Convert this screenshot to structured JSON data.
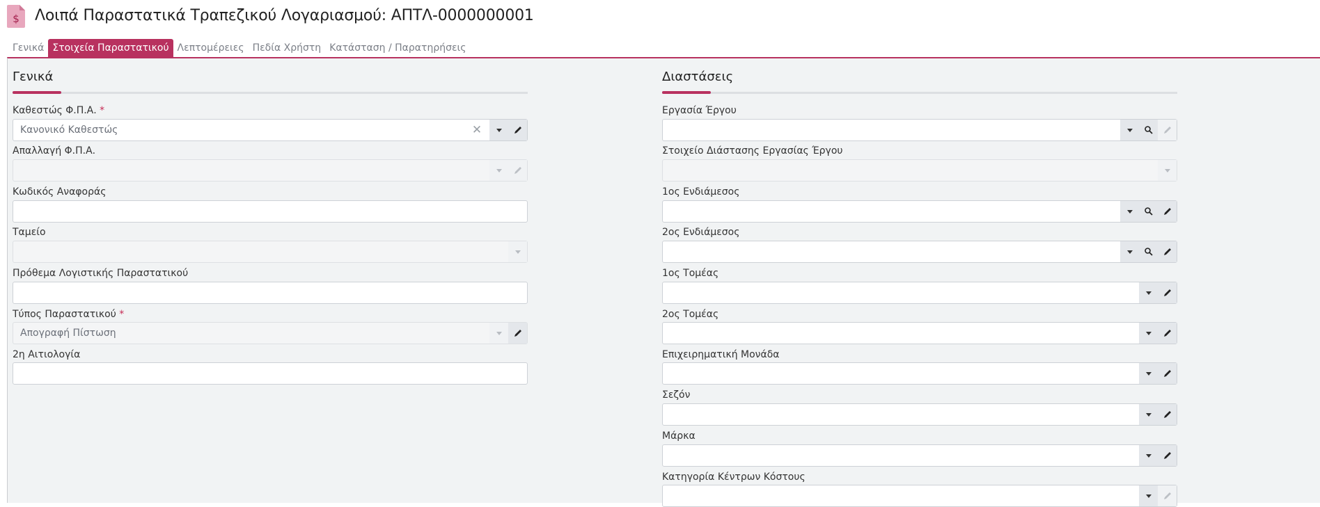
{
  "header": {
    "title": "Λοιπά Παραστατικά Τραπεζικού Λογαριασμού: ΑΠΤΛ-0000000001",
    "accent_color": "#b8315f"
  },
  "tabs": [
    {
      "label": "Γενικά"
    },
    {
      "label": "Στοιχεία Παραστατικού",
      "active": true
    },
    {
      "label": "Λεπτομέρειες"
    },
    {
      "label": "Πεδία Χρήστη"
    },
    {
      "label": "Κατάσταση / Παρατηρήσεις"
    }
  ],
  "left": {
    "title": "Γενικά",
    "fields": [
      {
        "label": "Καθεστώς Φ.Π.Α.",
        "required": "*",
        "value": "Κανονικό Καθεστώς",
        "buttons": [
          "clear",
          "dropdown",
          "edit"
        ]
      },
      {
        "label": "Απαλλαγή Φ.Π.Α.",
        "value": "",
        "disabled": true,
        "buttons": [
          "dropdown",
          "edit"
        ]
      },
      {
        "label": "Κωδικός Αναφοράς",
        "value": ""
      },
      {
        "label": "Ταμείο",
        "value": "",
        "disabled": true,
        "buttons": [
          "dropdown"
        ]
      },
      {
        "label": "Πρόθεμα Λογιστικής Παραστατικού",
        "value": ""
      },
      {
        "label": "Τύπος Παραστατικού",
        "required": "*",
        "value": "Απογραφή Πίστωση",
        "disabled": true,
        "buttons": [
          "dropdown",
          "edit"
        ]
      },
      {
        "label": "2η Αιτιολογία",
        "value": ""
      }
    ]
  },
  "right": {
    "title": "Διαστάσεις",
    "fields": [
      {
        "label": "Εργασία Έργου",
        "value": "",
        "buttons": [
          "dropdown",
          "search",
          "edit"
        ],
        "edit_disabled": true
      },
      {
        "label": "Στοιχείο Διάστασης Εργασίας Έργου",
        "value": "",
        "disabled": true,
        "buttons": [
          "dropdown"
        ]
      },
      {
        "label": "1ος Ενδιάμεσος",
        "value": "",
        "buttons": [
          "dropdown",
          "search",
          "edit"
        ]
      },
      {
        "label": "2ος Ενδιάμεσος",
        "value": "",
        "buttons": [
          "dropdown",
          "search",
          "edit"
        ]
      },
      {
        "label": "1ος Τομέας",
        "value": "",
        "buttons": [
          "dropdown",
          "edit"
        ]
      },
      {
        "label": "2ος Τομέας",
        "value": "",
        "buttons": [
          "dropdown",
          "edit"
        ]
      },
      {
        "label": "Επιχειρηματική Μονάδα",
        "value": "",
        "buttons": [
          "dropdown",
          "edit"
        ]
      },
      {
        "label": "Σεζόν",
        "value": "",
        "buttons": [
          "dropdown",
          "edit"
        ]
      },
      {
        "label": "Μάρκα",
        "value": "",
        "buttons": [
          "dropdown",
          "edit"
        ]
      },
      {
        "label": "Κατηγορία Κέντρων Κόστους",
        "value": "",
        "buttons": [
          "dropdown",
          "edit"
        ],
        "edit_disabled": true
      }
    ]
  }
}
